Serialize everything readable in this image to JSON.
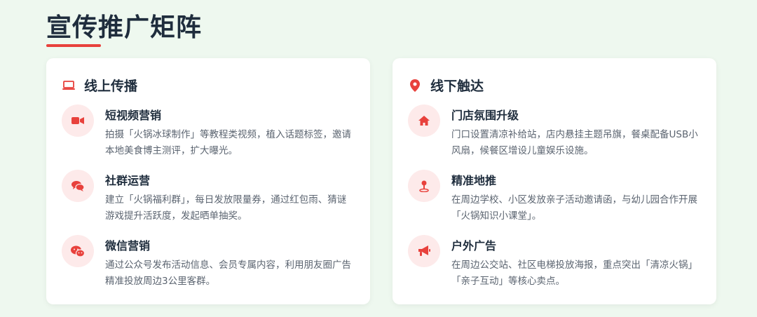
{
  "page": {
    "title": "宣传推广矩阵"
  },
  "colors": {
    "accent": "#e8413c",
    "icon_bg": "#fdeaea",
    "text_dark": "#1f2d3d",
    "text_muted": "#5b6470",
    "page_bg": "#eef8ef"
  },
  "online": {
    "icon": "laptop-icon",
    "title": "线上传播",
    "items": [
      {
        "icon": "video-camera-icon",
        "title": "短视频营销",
        "desc": "拍摄「火锅冰球制作」等教程类视频，植入话题标签，邀请本地美食博主测评，扩大曝光。"
      },
      {
        "icon": "chat-bubbles-icon",
        "title": "社群运营",
        "desc": "建立「火锅福利群」，每日发放限量券，通过红包雨、猜谜游戏提升活跃度，发起晒单抽奖。"
      },
      {
        "icon": "wechat-icon",
        "title": "微信营销",
        "desc": "通过公众号发布活动信息、会员专属内容，利用朋友圈广告精准投放周边3公里客群。"
      }
    ]
  },
  "offline": {
    "icon": "map-pin-icon",
    "title": "线下触达",
    "items": [
      {
        "icon": "home-icon",
        "title": "门店氛围升级",
        "desc": "门口设置清凉补给站，店内悬挂主题吊旗，餐桌配备USB小风扇，候餐区增设儿童娱乐设施。"
      },
      {
        "icon": "location-marker-icon",
        "title": "精准地推",
        "desc": "在周边学校、小区发放亲子活动邀请函，与幼儿园合作开展「火锅知识小课堂」。"
      },
      {
        "icon": "megaphone-icon",
        "title": "户外广告",
        "desc": "在周边公交站、社区电梯投放海报，重点突出「清凉火锅」「亲子互动」等核心卖点。"
      }
    ]
  }
}
